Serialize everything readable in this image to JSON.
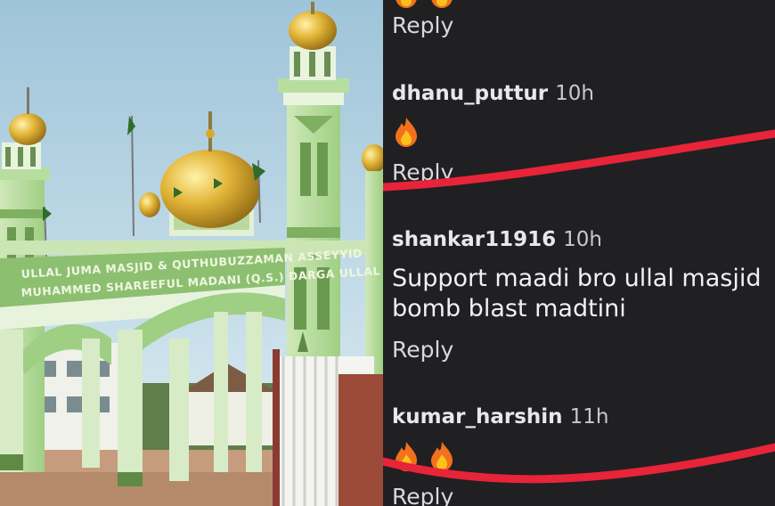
{
  "photo": {
    "description_icon": "mosque-photo",
    "sign_line1": "ULLAL JUMA MASJID & QUTHUBUZZAMAN ASSEYYID",
    "sign_line2": "MUHAMMED SHAREEFUL MADANI (Q.S.) DARGA ULLAL"
  },
  "comments": [
    {
      "kind": "reply-only",
      "reply_label": "Reply"
    },
    {
      "user": "dhanu_puttur",
      "time": "10h",
      "emoji_count": 1,
      "reply_label": "Reply"
    },
    {
      "user": "shankar11916",
      "time": "10h",
      "text_line1": "Support maadi bro ullal masjid",
      "text_line2": "bomb blast madtini",
      "reply_label": "Reply"
    },
    {
      "user": "kumar_harshin",
      "time": "11h",
      "emoji_count": 2,
      "reply_label": "Reply"
    }
  ],
  "colors": {
    "panel_bg": "#202022",
    "highlight_line": "#e8243a",
    "dome_gold": "#d9a92a",
    "mosque_green": "#9ecb82"
  }
}
